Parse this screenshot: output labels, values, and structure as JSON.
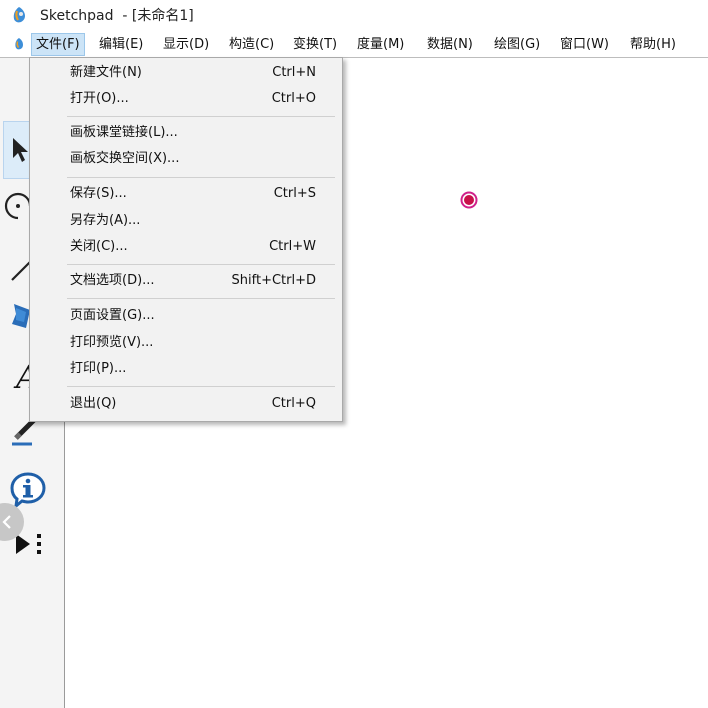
{
  "window": {
    "title": "Sketchpad  - [未命名1]",
    "app_icon": "sketchpad-logo-icon"
  },
  "menubar": {
    "items": [
      {
        "label": "文件(F)",
        "open": true
      },
      {
        "label": "编辑(E)"
      },
      {
        "label": "显示(D)"
      },
      {
        "label": "构造(C)"
      },
      {
        "label": "变换(T)"
      },
      {
        "label": "度量(M)"
      },
      {
        "label": "数据(N)"
      },
      {
        "label": "绘图(G)"
      },
      {
        "label": "窗口(W)"
      },
      {
        "label": "帮助(H)"
      }
    ]
  },
  "file_menu": {
    "groups": [
      [
        {
          "label": "新建文件(N)",
          "shortcut": "Ctrl+N"
        },
        {
          "label": "打开(O)...",
          "shortcut": "Ctrl+O"
        }
      ],
      [
        {
          "label": "画板课堂链接(L)...",
          "shortcut": ""
        },
        {
          "label": "画板交换空间(X)...",
          "shortcut": ""
        }
      ],
      [
        {
          "label": "保存(S)...",
          "shortcut": "Ctrl+S"
        },
        {
          "label": "另存为(A)...",
          "shortcut": ""
        },
        {
          "label": "关闭(C)...",
          "shortcut": "Ctrl+W"
        }
      ],
      [
        {
          "label": "文档选项(D)...",
          "shortcut": "Shift+Ctrl+D"
        }
      ],
      [
        {
          "label": "页面设置(G)...",
          "shortcut": ""
        },
        {
          "label": "打印预览(V)...",
          "shortcut": ""
        },
        {
          "label": "打印(P)...",
          "shortcut": ""
        }
      ],
      [
        {
          "label": "退出(Q)",
          "shortcut": "Ctrl+Q"
        }
      ]
    ]
  },
  "toolbox": {
    "tools": [
      "arrow-select-icon",
      "compass-circle-icon",
      "straightedge-icon",
      "polygon-icon",
      "text-tool-icon",
      "marker-pen-icon",
      "information-icon",
      "custom-tool-icon"
    ],
    "selected": "arrow-select-icon"
  },
  "colors": {
    "point": "#c8104a",
    "menu_highlight": "#cce4f7",
    "dropdown_bg": "#f2f2f2",
    "toolbox_bg": "#f4f4f4"
  }
}
